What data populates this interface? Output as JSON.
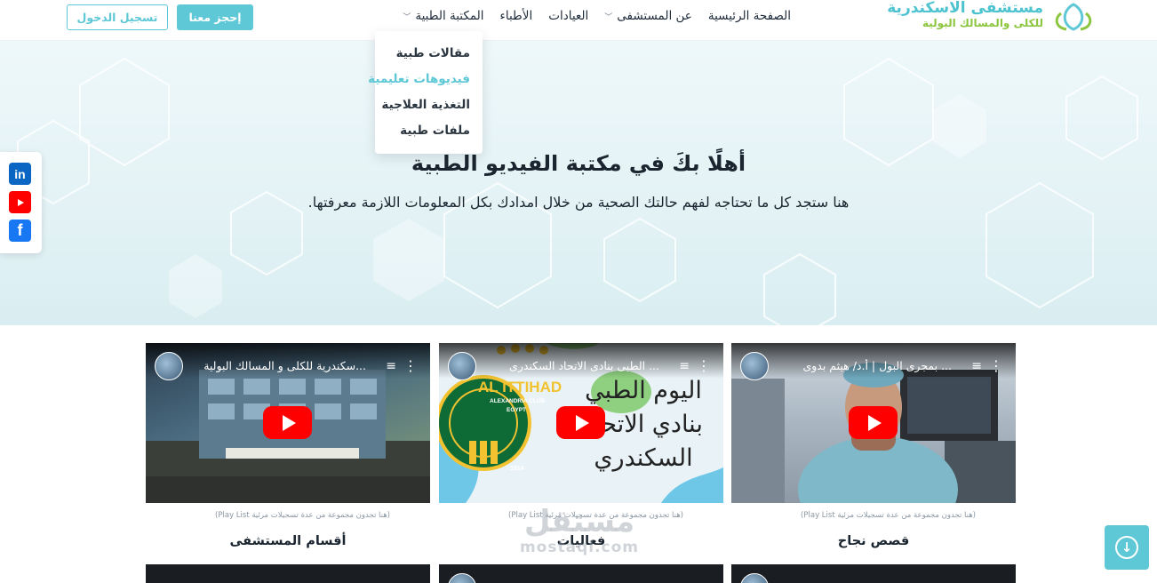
{
  "header": {
    "logo_line1": "مستشفى الاسكندرية",
    "logo_line2": "للكلى والمسالك البولية",
    "nav": [
      {
        "label": "الصفحة الرئيسية",
        "has_dropdown": false
      },
      {
        "label": "عن المستشفى",
        "has_dropdown": true
      },
      {
        "label": "العيادات",
        "has_dropdown": false
      },
      {
        "label": "الأطباء",
        "has_dropdown": false
      },
      {
        "label": "المكتبة الطبية",
        "has_dropdown": true
      }
    ],
    "book_label": "إحجز معنا",
    "login_label": "تسجيل الدخول",
    "colors": {
      "accent": "#5ec8d6",
      "green": "#8cc63f"
    }
  },
  "dropdown": {
    "items": [
      {
        "label": "مقالات طبية",
        "active": false
      },
      {
        "label": "فيديوهات تعليمية",
        "active": true
      },
      {
        "label": "التغذية العلاجية",
        "active": false
      },
      {
        "label": "ملفات طبية",
        "active": false
      }
    ]
  },
  "hero": {
    "title": "أهلًا بكَ في مكتبة الفيديو الطبية",
    "subtitle": "هنا ستجد كل ما تحتاجه لفهم حالتك الصحية من خلال امدادك بكل المعلومات اللازمة معرفتها."
  },
  "social": [
    {
      "name": "linkedin-icon",
      "glyph": "in"
    },
    {
      "name": "youtube-icon",
      "glyph": ""
    },
    {
      "name": "facebook-icon",
      "glyph": "f"
    }
  ],
  "cards": [
    {
      "video_title": "...سكندرية للكلى و المسالك البولية",
      "note": "(هنا تجدون مجموعة من عدة تسجيلات مرئية Play List)",
      "title": "أقسام المستشفى"
    },
    {
      "video_title": "... الطبى بنادى الاتحاد السكندرى",
      "note": "(هنا تجدون مجموعة من عدة تسجيلات مرئية Play List)",
      "title": "فعاليات",
      "thumb_text": "اليوم الطبي بنادي الاتحاد السكندري",
      "club_name": "AL ITTIHAD",
      "club_sub": "ALEXANDRIA CLUB",
      "club_country": "EGYPT",
      "club_year": "1914"
    },
    {
      "video_title": "... بمجرى البول | أ.د/ هيثم بدوى",
      "note": "(هنا تجدون مجموعة من عدة تسجيلات مرئية Play List)",
      "title": "قصص نجاح"
    }
  ],
  "watermark": {
    "line1": "مستقل",
    "line2": "mostaql.com"
  }
}
